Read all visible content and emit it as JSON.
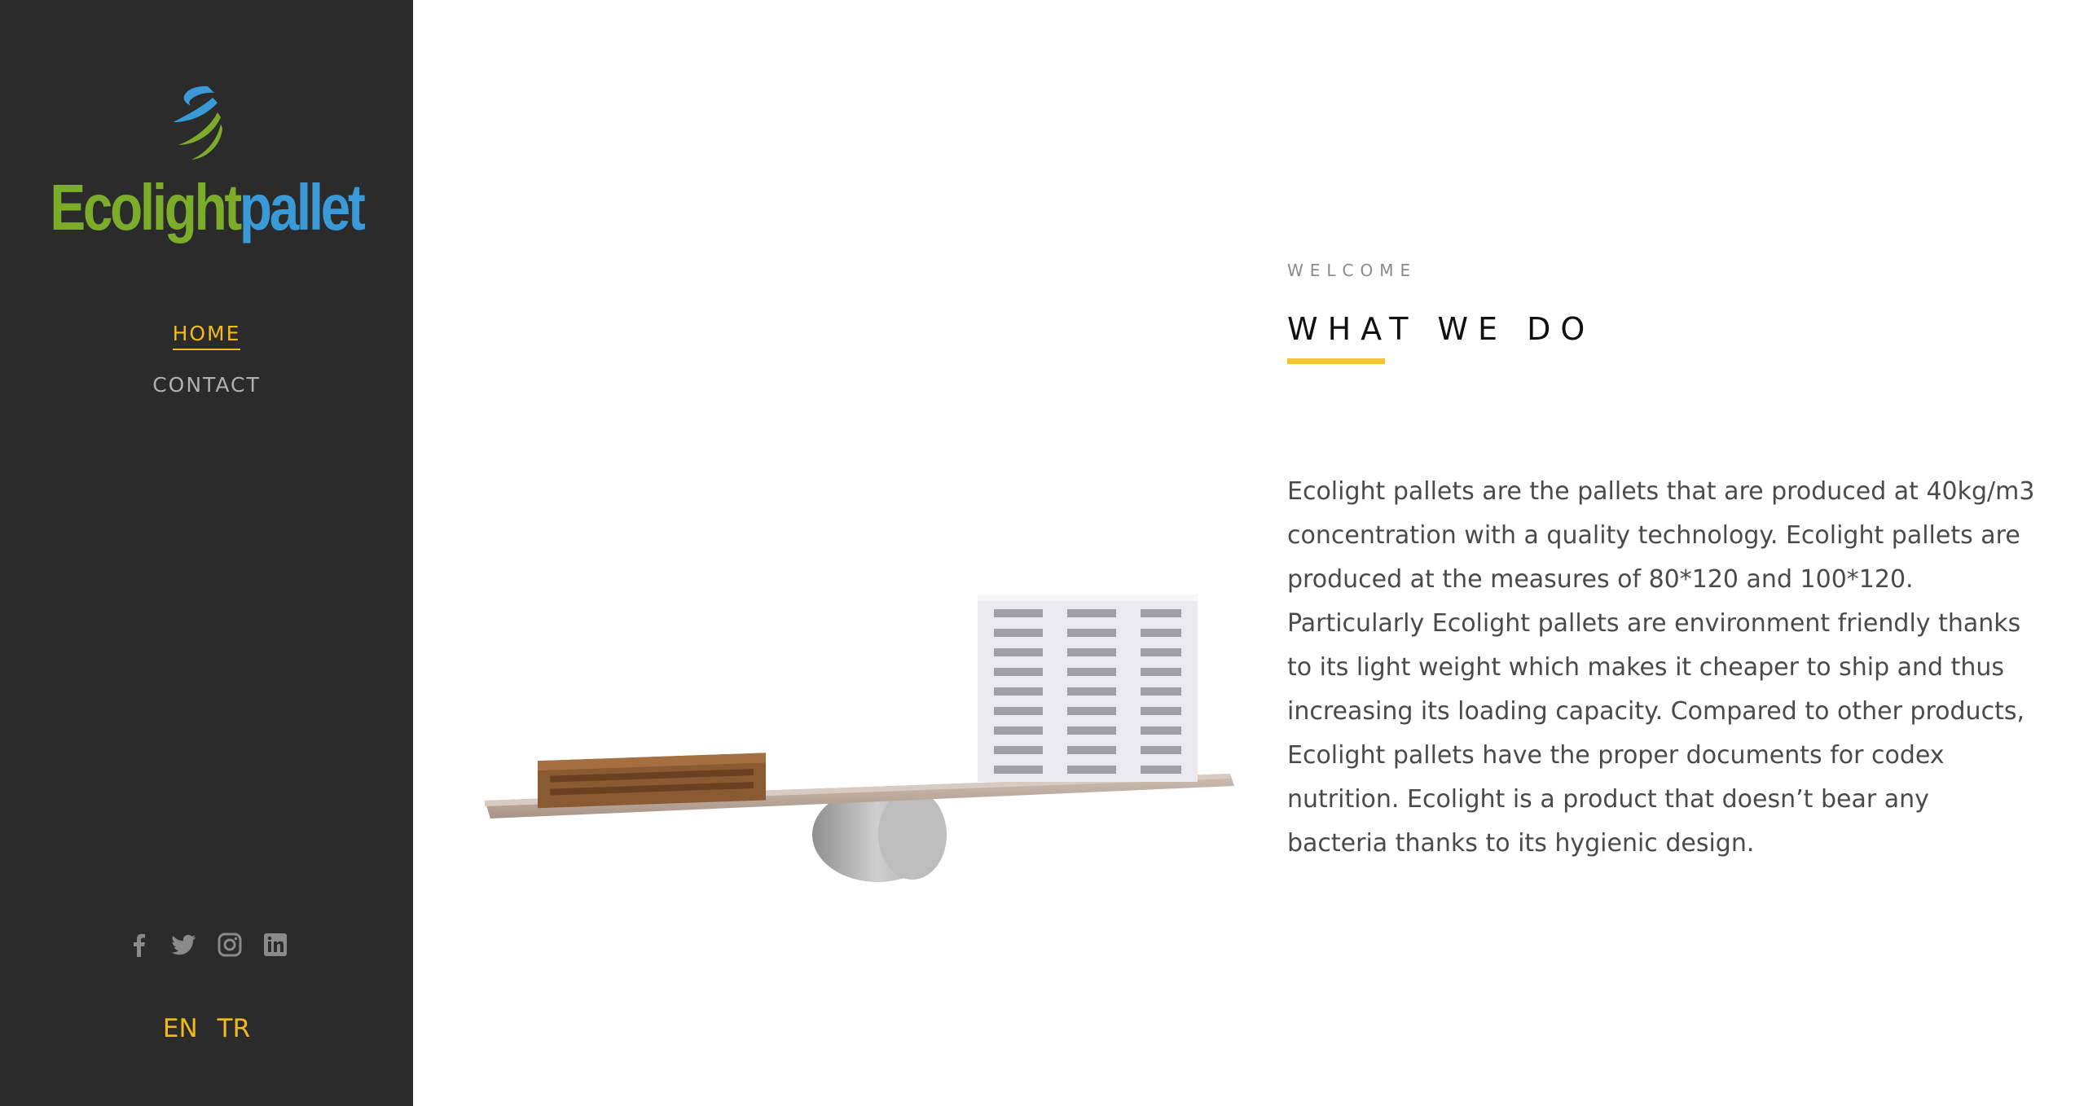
{
  "brand": {
    "name_part1": "Ecolight",
    "name_part2": "pallet",
    "colors": {
      "green": "#7cad2a",
      "blue": "#3a9ad8"
    }
  },
  "nav": {
    "items": [
      {
        "label": "HOME",
        "active": true
      },
      {
        "label": "CONTACT",
        "active": false
      }
    ]
  },
  "social": {
    "icons": [
      "facebook-icon",
      "twitter-icon",
      "instagram-icon",
      "linkedin-icon"
    ]
  },
  "languages": [
    "EN",
    "TR"
  ],
  "main": {
    "kicker": "WELCOME",
    "heading": "WHAT WE DO",
    "body": "Ecolight pallets are the pallets that are produced at 40kg/m3 concentration with a quality technology. Ecolight pallets are produced at the measures of 80*120 and 100*120. Particularly Ecolight pallets are environment friendly thanks to its light weight which makes it cheaper to ship and thus increasing its loading capacity. Compared to other products, Ecolight pallets have the proper documents for codex nutrition. Ecolight is a product that doesn’t bear any bacteria thanks to its hygienic design."
  },
  "theme": {
    "sidebar_bg": "#2b2b2b",
    "accent": "#f2b91d",
    "underline": "#f2c531"
  }
}
